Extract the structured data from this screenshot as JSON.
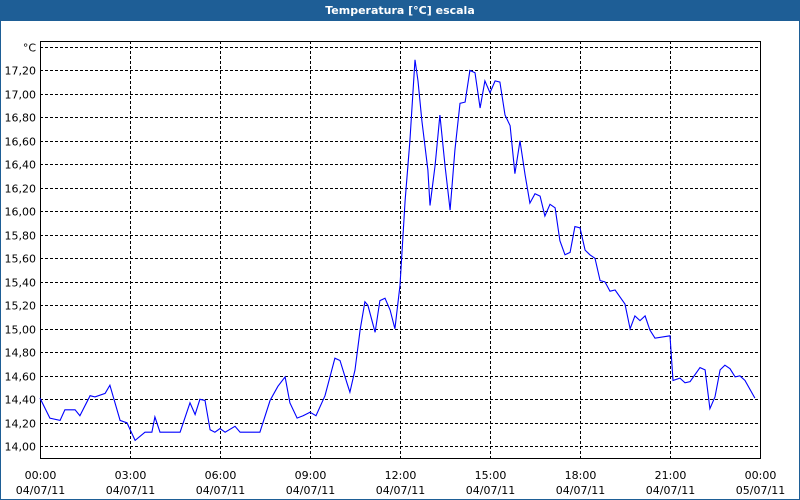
{
  "window": {
    "title": "Temperatura [°C] escala"
  },
  "colors": {
    "titlebar": "#1e5e96",
    "line": "#0000ff",
    "grid": "#000000"
  },
  "chart_data": {
    "type": "line",
    "title": "Temperatura [°C] escala",
    "ylabel": "°C",
    "xlabel": "",
    "ylim": [
      13.9,
      17.45
    ],
    "xlim_hours": [
      0,
      24
    ],
    "grid": true,
    "y_ticks": [
      "14,00",
      "14,20",
      "14,40",
      "14,60",
      "14,80",
      "15,00",
      "15,20",
      "15,40",
      "15,60",
      "15,80",
      "16,00",
      "16,20",
      "16,40",
      "16,60",
      "16,80",
      "17,00",
      "17,20"
    ],
    "y_tick_values": [
      14.0,
      14.2,
      14.4,
      14.6,
      14.8,
      15.0,
      15.2,
      15.4,
      15.6,
      15.8,
      16.0,
      16.2,
      16.4,
      16.6,
      16.8,
      17.0,
      17.2
    ],
    "x_ticks": [
      {
        "hour": 0,
        "time": "00:00",
        "date": "04/07/11"
      },
      {
        "hour": 3,
        "time": "03:00",
        "date": "04/07/11"
      },
      {
        "hour": 6,
        "time": "06:00",
        "date": "04/07/11"
      },
      {
        "hour": 9,
        "time": "09:00",
        "date": "04/07/11"
      },
      {
        "hour": 12,
        "time": "12:00",
        "date": "04/07/11"
      },
      {
        "hour": 15,
        "time": "15:00",
        "date": "04/07/11"
      },
      {
        "hour": 18,
        "time": "18:00",
        "date": "04/07/11"
      },
      {
        "hour": 21,
        "time": "21:00",
        "date": "04/07/11"
      },
      {
        "hour": 24,
        "time": "00:00",
        "date": "05/07/11"
      }
    ],
    "series": [
      {
        "name": "Temperatura",
        "x_hours": [
          0,
          0.33,
          0.67,
          0.83,
          1.17,
          1.33,
          1.67,
          1.83,
          2.17,
          2.33,
          2.67,
          2.9,
          3.17,
          3.5,
          3.73,
          3.83,
          4.0,
          4.67,
          5.0,
          5.17,
          5.33,
          5.5,
          5.67,
          5.83,
          6.0,
          6.17,
          6.5,
          6.67,
          7.33,
          7.67,
          7.93,
          8.17,
          8.33,
          8.57,
          8.77,
          9.0,
          9.2,
          9.5,
          9.83,
          10.0,
          10.23,
          10.33,
          10.5,
          10.67,
          10.83,
          10.93,
          11.17,
          11.33,
          11.5,
          11.67,
          11.83,
          12.0,
          12.17,
          12.33,
          12.5,
          12.6,
          12.73,
          12.93,
          13.0,
          13.17,
          13.33,
          13.5,
          13.67,
          13.83,
          14.0,
          14.17,
          14.33,
          14.5,
          14.67,
          14.83,
          15.0,
          15.17,
          15.33,
          15.5,
          15.67,
          15.83,
          16.0,
          16.17,
          16.33,
          16.5,
          16.67,
          16.83,
          17.0,
          17.17,
          17.33,
          17.5,
          17.67,
          17.83,
          18.0,
          18.17,
          18.33,
          18.5,
          18.67,
          18.83,
          19.0,
          19.17,
          19.5,
          19.67,
          19.83,
          20.0,
          20.17,
          20.33,
          20.5,
          21.0,
          21.1,
          21.33,
          21.5,
          21.67,
          22.0,
          22.17,
          22.33,
          22.5,
          22.67,
          22.83,
          23.0,
          23.17,
          23.33,
          23.5,
          23.83
        ],
        "values": [
          14.41,
          14.24,
          14.22,
          14.31,
          14.31,
          14.26,
          14.43,
          14.42,
          14.45,
          14.52,
          14.22,
          14.2,
          14.05,
          14.12,
          14.12,
          14.25,
          14.12,
          14.12,
          14.37,
          14.27,
          14.4,
          14.39,
          14.14,
          14.12,
          14.15,
          14.12,
          14.17,
          14.12,
          14.12,
          14.39,
          14.51,
          14.59,
          14.37,
          14.24,
          14.26,
          14.29,
          14.26,
          14.43,
          14.75,
          14.73,
          14.54,
          14.46,
          14.65,
          14.99,
          15.23,
          15.2,
          14.97,
          15.24,
          15.26,
          15.16,
          15.0,
          15.37,
          16.09,
          16.6,
          17.29,
          17.11,
          16.77,
          16.35,
          16.05,
          16.39,
          16.82,
          16.39,
          16.01,
          16.52,
          16.92,
          16.93,
          17.2,
          17.18,
          16.88,
          17.11,
          17.01,
          17.11,
          17.1,
          16.82,
          16.73,
          16.32,
          16.6,
          16.31,
          16.07,
          16.15,
          16.13,
          15.96,
          16.06,
          16.03,
          15.75,
          15.63,
          15.65,
          15.87,
          15.86,
          15.67,
          15.63,
          15.6,
          15.41,
          15.4,
          15.32,
          15.33,
          15.21,
          15.0,
          15.11,
          15.07,
          15.11,
          14.99,
          14.92,
          14.94,
          14.56,
          14.58,
          14.54,
          14.55,
          14.67,
          14.65,
          14.32,
          14.42,
          14.65,
          14.69,
          14.66,
          14.59,
          14.6,
          14.56,
          14.41
        ]
      }
    ]
  }
}
